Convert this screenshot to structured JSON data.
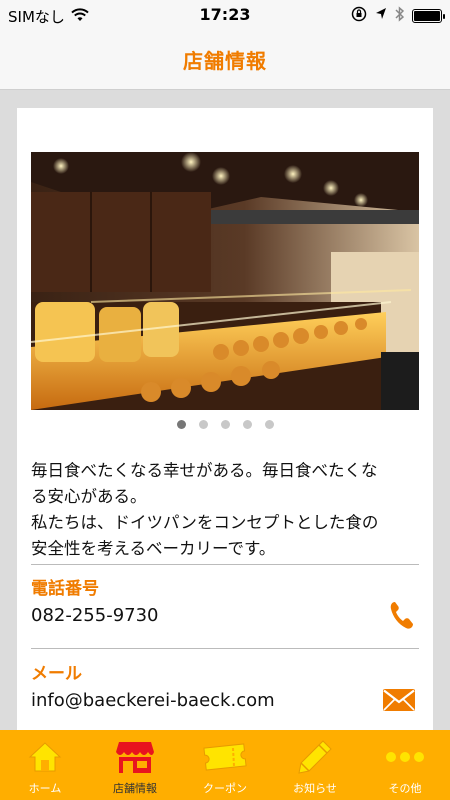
{
  "status_bar": {
    "carrier": "SIMなし",
    "time": "17:23"
  },
  "nav": {
    "title": "店舗情報"
  },
  "gallery": {
    "image_description": "bakery interior with bread display counter",
    "page_count": 5,
    "active_page": 1
  },
  "store": {
    "description_lines": [
      "毎日食べたくなる幸せがある。毎日食べたくな",
      "る安心がある。",
      "私たちは、ドイツパンをコンセプトとした食の",
      "安全性を考えるベーカリーです。"
    ],
    "phone_label": "電話番号",
    "phone": "082-255-9730",
    "email_label": "メール",
    "email": "info@baeckerei-baeck.com"
  },
  "tabs": [
    {
      "label": "ホーム",
      "icon": "home-icon"
    },
    {
      "label": "店舗情報",
      "icon": "shop-icon"
    },
    {
      "label": "クーポン",
      "icon": "ticket-icon"
    },
    {
      "label": "お知らせ",
      "icon": "pencil-icon"
    },
    {
      "label": "その他",
      "icon": "more-icon"
    }
  ],
  "colors": {
    "accent": "#f07c00",
    "tab_bar": "#ffae00",
    "tab_icon": "#ffe400",
    "active_tab_icon": "#e8141e"
  }
}
